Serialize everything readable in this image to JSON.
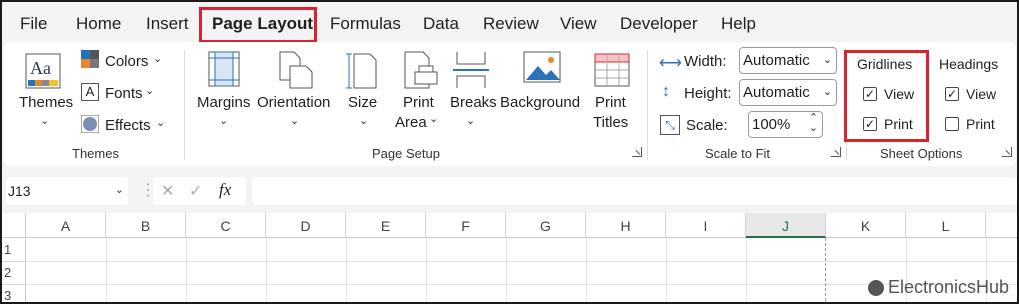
{
  "tabs": [
    "File",
    "Home",
    "Insert",
    "Page Layout",
    "Formulas",
    "Data",
    "Review",
    "View",
    "Developer",
    "Help"
  ],
  "themes": {
    "themes_label": "Themes",
    "colors": "Colors",
    "fonts": "Fonts",
    "effects": "Effects",
    "group": "Themes",
    "aa": "Aa"
  },
  "page_setup": {
    "margins": "Margins",
    "orientation": "Orientation",
    "size": "Size",
    "print_area_1": "Print",
    "print_area_2": "Area",
    "breaks": "Breaks",
    "background": "Background",
    "print_titles_1": "Print",
    "print_titles_2": "Titles",
    "group": "Page Setup"
  },
  "scale": {
    "width_label": "Width:",
    "width_value": "Automatic",
    "height_label": "Height:",
    "height_value": "Automatic",
    "scale_label": "Scale:",
    "scale_value": "100%",
    "group": "Scale to Fit"
  },
  "sheet_options": {
    "gridlines": "Gridlines",
    "headings": "Headings",
    "view": "View",
    "print": "Print",
    "group": "Sheet Options",
    "gridlines_view_checked": true,
    "gridlines_print_checked": true,
    "headings_view_checked": true,
    "headings_print_checked": false
  },
  "formula_bar": {
    "name_box": "J13",
    "fx": "fx",
    "cancel": "✕",
    "enter": "✓"
  },
  "columns": [
    "A",
    "B",
    "C",
    "D",
    "E",
    "F",
    "G",
    "H",
    "I",
    "J",
    "K",
    "L"
  ],
  "rows": [
    "1",
    "2",
    "3"
  ],
  "active_column": "J",
  "watermark": "ElectronicsHub",
  "colors": {
    "accent_red": "#d9232e",
    "active_col": "#1e7145"
  }
}
